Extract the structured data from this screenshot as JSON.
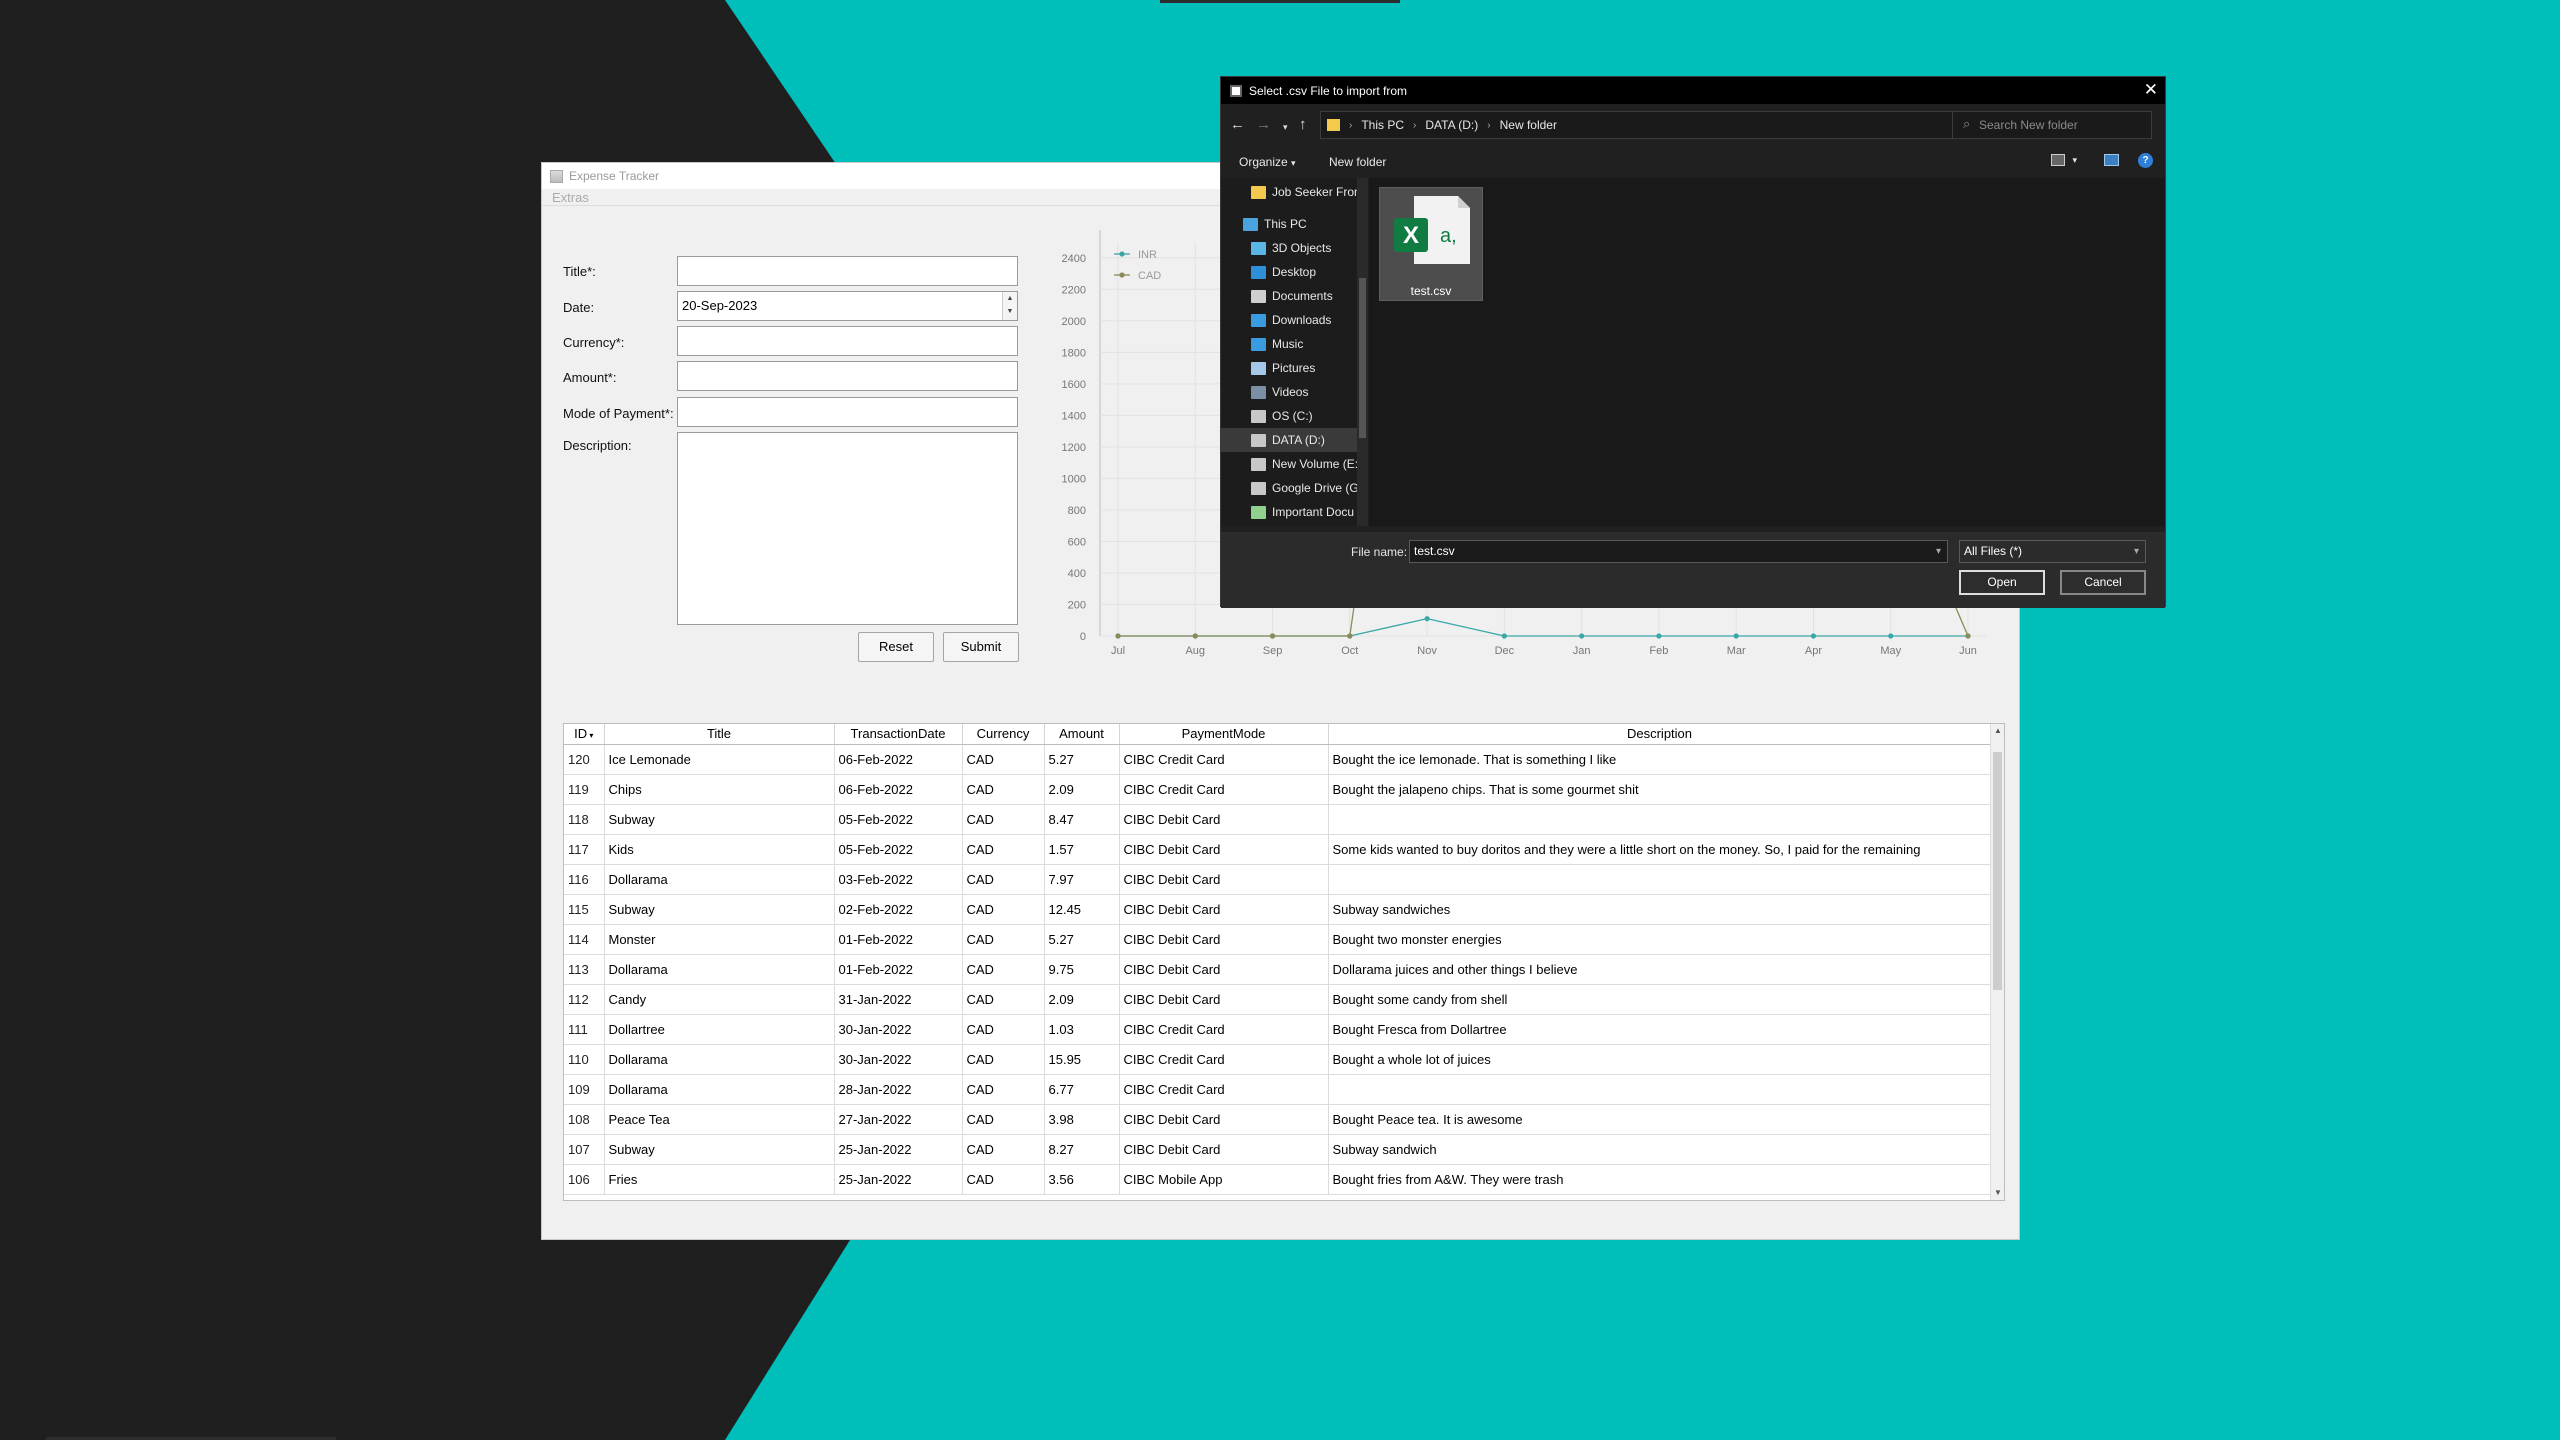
{
  "expense_app": {
    "window_title": "Expense Tracker",
    "menu": {
      "extras": "Extras"
    },
    "form": {
      "title_label": "Title*:",
      "date_label": "Date:",
      "date_value": "20-Sep-2023",
      "currency_label": "Currency*:",
      "amount_label": "Amount*:",
      "mode_label": "Mode of Payment*:",
      "description_label": "Description:",
      "reset_label": "Reset",
      "submit_label": "Submit"
    },
    "table": {
      "columns": [
        "ID",
        "Title",
        "TransactionDate",
        "Currency",
        "Amount",
        "PaymentMode",
        "Description"
      ],
      "rows": [
        [
          "120",
          "Ice Lemonade",
          "06-Feb-2022",
          "CAD",
          "5.27",
          "CIBC Credit Card",
          "Bought the ice lemonade. That is something I like"
        ],
        [
          "119",
          "Chips",
          "06-Feb-2022",
          "CAD",
          "2.09",
          "CIBC Credit Card",
          "Bought the jalapeno chips. That is some gourmet shit"
        ],
        [
          "118",
          "Subway",
          "05-Feb-2022",
          "CAD",
          "8.47",
          "CIBC Debit Card",
          ""
        ],
        [
          "117",
          "Kids",
          "05-Feb-2022",
          "CAD",
          "1.57",
          "CIBC Debit Card",
          "Some kids wanted to buy doritos and they were a little short on the money. So, I paid for the remaining"
        ],
        [
          "116",
          "Dollarama",
          "03-Feb-2022",
          "CAD",
          "7.97",
          "CIBC Debit Card",
          ""
        ],
        [
          "115",
          "Subway",
          "02-Feb-2022",
          "CAD",
          "12.45",
          "CIBC Debit Card",
          "Subway sandwiches"
        ],
        [
          "114",
          "Monster",
          "01-Feb-2022",
          "CAD",
          "5.27",
          "CIBC Debit Card",
          "Bought two monster energies"
        ],
        [
          "113",
          "Dollarama",
          "01-Feb-2022",
          "CAD",
          "9.75",
          "CIBC Debit Card",
          "Dollarama juices and other things I believe"
        ],
        [
          "112",
          "Candy",
          "31-Jan-2022",
          "CAD",
          "2.09",
          "CIBC Debit Card",
          "Bought some candy from shell"
        ],
        [
          "111",
          "Dollartree",
          "30-Jan-2022",
          "CAD",
          "1.03",
          "CIBC Credit Card",
          "Bought Fresca from Dollartree"
        ],
        [
          "110",
          "Dollarama",
          "30-Jan-2022",
          "CAD",
          "15.95",
          "CIBC Credit Card",
          "Bought a whole lot of juices"
        ],
        [
          "109",
          "Dollarama",
          "28-Jan-2022",
          "CAD",
          "6.77",
          "CIBC Credit Card",
          ""
        ],
        [
          "108",
          "Peace Tea",
          "27-Jan-2022",
          "CAD",
          "3.98",
          "CIBC Debit Card",
          "Bought Peace tea. It is awesome"
        ],
        [
          "107",
          "Subway",
          "25-Jan-2022",
          "CAD",
          "8.27",
          "CIBC Debit Card",
          "Subway sandwich"
        ],
        [
          "106",
          "Fries",
          "25-Jan-2022",
          "CAD",
          "3.56",
          "CIBC Mobile App",
          "Bought fries from A&W. They were trash"
        ]
      ]
    }
  },
  "chart_data": {
    "type": "line",
    "categories": [
      "Jul",
      "Aug",
      "Sep",
      "Oct",
      "Nov",
      "Dec",
      "Jan",
      "Feb",
      "Mar",
      "Apr",
      "May",
      "Jun"
    ],
    "y_ticks": [
      0,
      200,
      400,
      600,
      800,
      1000,
      1200,
      1400,
      1600,
      1800,
      2000,
      2200,
      2400
    ],
    "ylim": [
      0,
      2500
    ],
    "series": [
      {
        "name": "INR",
        "color": "#3aa6a6",
        "values": [
          0,
          0,
          0,
          0,
          110,
          0,
          0,
          0,
          0,
          0,
          0,
          0
        ]
      },
      {
        "name": "CAD",
        "color": "#8a8a5a",
        "values": [
          0,
          0,
          0,
          0,
          null,
          null,
          null,
          null,
          null,
          null,
          null,
          0
        ]
      }
    ],
    "legend": "top-left",
    "grid": true
  },
  "file_dialog": {
    "title": "Select .csv File to import from",
    "path": [
      "This PC",
      "DATA (D:)",
      "New folder"
    ],
    "search_placeholder": "Search New folder",
    "organize": "Organize",
    "new_folder": "New folder",
    "nav_items": [
      {
        "label": "Job Seeker Front",
        "icon": "folder-icon",
        "color": "#f3c94e"
      },
      {
        "label": "This PC",
        "icon": "computer-icon",
        "color": "#4aa3df"
      },
      {
        "label": "3D Objects",
        "icon": "cube-icon",
        "color": "#5bb6e8"
      },
      {
        "label": "Desktop",
        "icon": "desktop-icon",
        "color": "#2f8fd8"
      },
      {
        "label": "Documents",
        "icon": "document-icon",
        "color": "#cfcfcf"
      },
      {
        "label": "Downloads",
        "icon": "download-icon",
        "color": "#3a9be0"
      },
      {
        "label": "Music",
        "icon": "music-icon",
        "color": "#3a9be0"
      },
      {
        "label": "Pictures",
        "icon": "pictures-icon",
        "color": "#a6c8e8"
      },
      {
        "label": "Videos",
        "icon": "video-icon",
        "color": "#7a8ea6"
      },
      {
        "label": "OS (C:)",
        "icon": "drive-icon",
        "color": "#c8c8c8"
      },
      {
        "label": "DATA (D:)",
        "icon": "drive-icon",
        "color": "#c8c8c8"
      },
      {
        "label": "New Volume (E:)",
        "icon": "drive-icon",
        "color": "#c8c8c8"
      },
      {
        "label": "Google Drive (G:",
        "icon": "drive-icon",
        "color": "#c8c8c8"
      },
      {
        "label": "Important Docu",
        "icon": "network-drive-icon",
        "color": "#8fd18f"
      }
    ],
    "file": {
      "name": "test.csv",
      "icon": "excel-csv-icon"
    },
    "file_name_label": "File name:",
    "file_name_value": "test.csv",
    "file_type_value": "All Files (*)",
    "open_label": "Open",
    "cancel_label": "Cancel"
  }
}
